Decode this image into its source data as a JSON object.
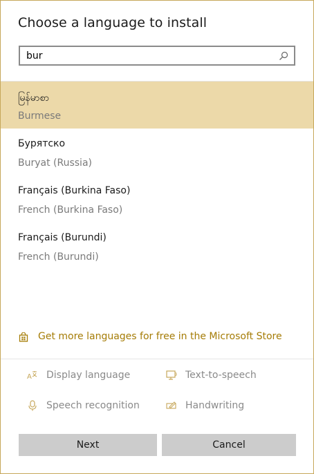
{
  "dialog": {
    "title": "Choose a language to install",
    "accent_color": "#c6a75a",
    "selected_color": "#ecd9a9",
    "link_color": "#a57c06"
  },
  "search": {
    "value": "bur",
    "icon": "search-icon"
  },
  "languages": [
    {
      "native": "မြန်မာစာ",
      "english": "Burmese",
      "selected": true
    },
    {
      "native": "Бурятско",
      "english": "Buryat (Russia)",
      "selected": false
    },
    {
      "native": "Français (Burkina Faso)",
      "english": "French (Burkina Faso)",
      "selected": false
    },
    {
      "native": "Français (Burundi)",
      "english": "French (Burundi)",
      "selected": false
    }
  ],
  "store_link": {
    "label": "Get more languages for free in the Microsoft Store",
    "icon": "store-bag-icon"
  },
  "features": {
    "display_language": {
      "label": "Display language",
      "icon": "display-language-icon"
    },
    "text_to_speech": {
      "label": "Text-to-speech",
      "icon": "text-to-speech-icon"
    },
    "speech_recognition": {
      "label": "Speech recognition",
      "icon": "microphone-icon"
    },
    "handwriting": {
      "label": "Handwriting",
      "icon": "handwriting-icon"
    }
  },
  "buttons": {
    "next": "Next",
    "cancel": "Cancel"
  }
}
